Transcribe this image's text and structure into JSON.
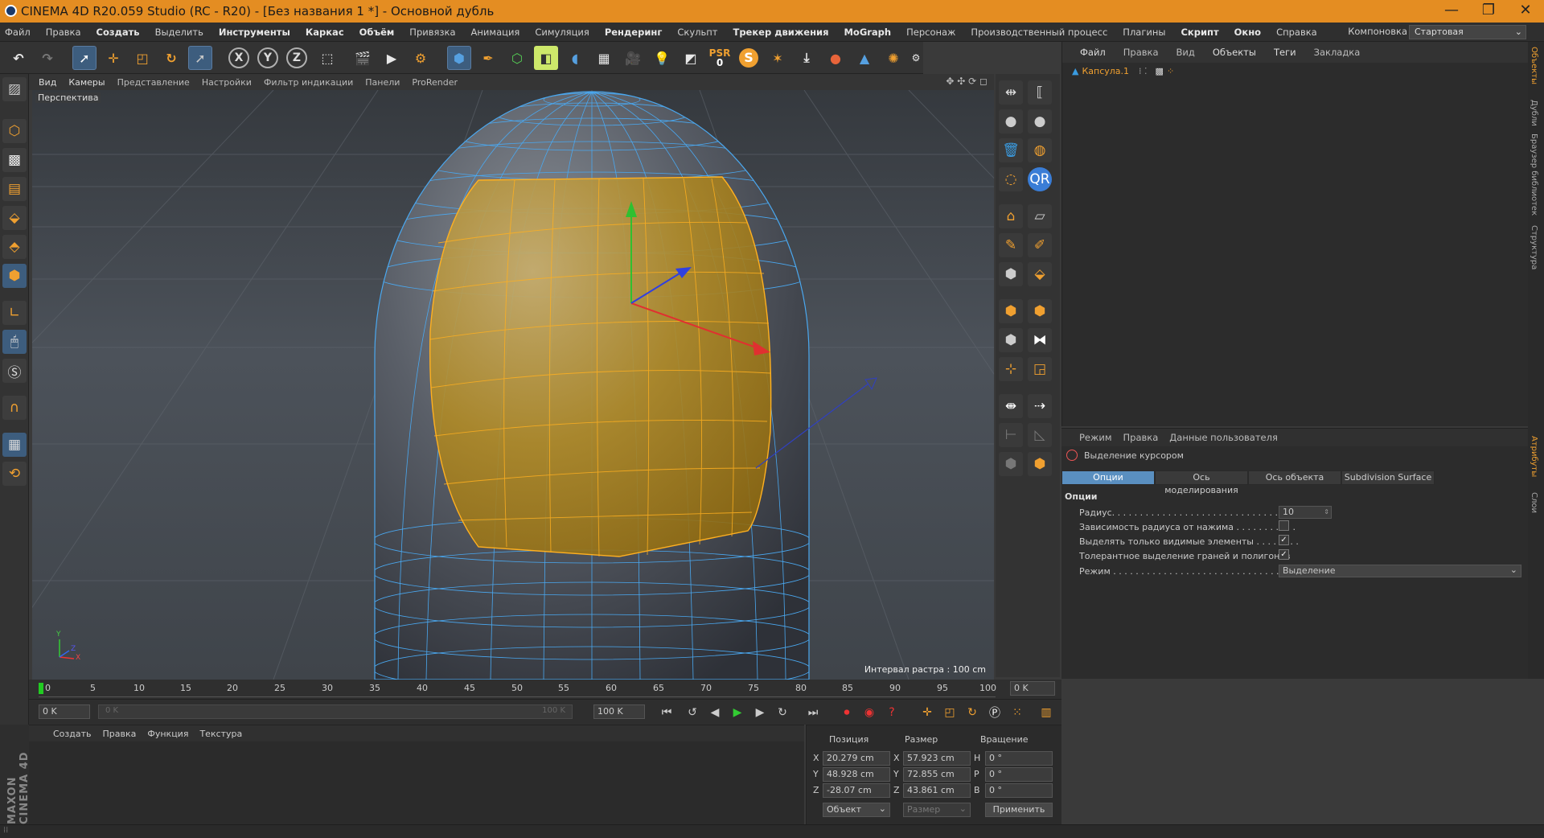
{
  "window": {
    "title": "CINEMA 4D R20.059 Studio (RC - R20) - [Без названия 1 *] - Основной дубль",
    "minimize": "—",
    "maximize": "❐",
    "close": "✕"
  },
  "menu": {
    "items": [
      "Файл",
      "Правка",
      "Создать",
      "Выделить",
      "Инструменты",
      "Каркас",
      "Объём",
      "Привязка",
      "Анимация",
      "Симуляция",
      "Рендеринг",
      "Скульпт",
      "Трекер движения",
      "MoGraph",
      "Персонаж",
      "Производственный процесс",
      "Плагины",
      "Скрипт",
      "Окно",
      "Справка"
    ],
    "layout_label": "Компоновка",
    "layout_value": "Стартовая"
  },
  "toolbar": {
    "psr_label": "PSR",
    "psr_value": "0",
    "axis_x": "X",
    "axis_y": "Y",
    "axis_z": "Z"
  },
  "viewport": {
    "menu": [
      "Вид",
      "Камеры",
      "Представление",
      "Настройки",
      "Фильтр индикации",
      "Панели",
      "ProRender"
    ],
    "camera_label": "Перспектива",
    "grid_info": "Интервал растра : 100 cm",
    "axis_y_label": "Y",
    "axis_z_label": "Z",
    "axis_x_label": "X"
  },
  "object_manager": {
    "menu": [
      "Файл",
      "Правка",
      "Вид",
      "Объекты",
      "Теги",
      "Закладка"
    ],
    "objects": [
      {
        "name": "Капсула.1"
      }
    ]
  },
  "attribute_manager": {
    "menu": [
      "Режим",
      "Правка",
      "Данные пользователя"
    ],
    "tool_name": "Выделение курсором",
    "tabs": [
      "Опции",
      "Ось моделирования",
      "Ось объекта",
      "Subdivision Surface"
    ],
    "active_tab": "Опции",
    "section": "Опции",
    "options": [
      {
        "label": "Радиус. . . . . . . . . . . . . . . . . . . . . . . . . . . . . . . . . . . . . . .",
        "type": "number",
        "value": "10"
      },
      {
        "label": "Зависимость радиуса от нажима . . . . . . . . . . .",
        "type": "checkbox",
        "checked": false
      },
      {
        "label": "Выделять только видимые элементы . . . . . . . .",
        "type": "checkbox",
        "checked": true
      },
      {
        "label": "Толерантное выделение граней и полигонов",
        "type": "checkbox",
        "checked": true
      },
      {
        "label": "Режим . . . . . . . . . . . . . . . . . . . . . . . . . . . . . . . . . . . . . . . .",
        "type": "select",
        "value": "Выделение"
      }
    ]
  },
  "side_tabs": [
    "Объекты",
    "Дубли",
    "Браузер библиотек",
    "Структура",
    "Атрибуты",
    "Слои"
  ],
  "timeline": {
    "ticks": [
      "0",
      "5",
      "10",
      "15",
      "20",
      "25",
      "30",
      "35",
      "40",
      "45",
      "50",
      "55",
      "60",
      "65",
      "70",
      "75",
      "80",
      "85",
      "90",
      "95",
      "100"
    ],
    "current_frame": "0 K",
    "start": "0 K",
    "preview_start": "0 K",
    "preview_end": "100 K",
    "end": "100 K"
  },
  "material_manager": {
    "menu": [
      "Создать",
      "Правка",
      "Функция",
      "Текстура"
    ]
  },
  "coordinates": {
    "headers": [
      "Позиция",
      "Размер",
      "Вращение"
    ],
    "rows": [
      {
        "axis": "X",
        "pos": "20.279 cm",
        "size_axis": "X",
        "size": "57.923 cm",
        "rot_axis": "H",
        "rot": "0 °"
      },
      {
        "axis": "Y",
        "pos": "48.928 cm",
        "size_axis": "Y",
        "size": "72.855 cm",
        "rot_axis": "P",
        "rot": "0 °"
      },
      {
        "axis": "Z",
        "pos": "-28.07 cm",
        "size_axis": "Z",
        "size": "43.861 cm",
        "rot_axis": "B",
        "rot": "0 °"
      }
    ],
    "mode": "Объект",
    "size_mode": "Размер",
    "apply": "Применить"
  },
  "brand": "MAXON CINEMA 4D"
}
